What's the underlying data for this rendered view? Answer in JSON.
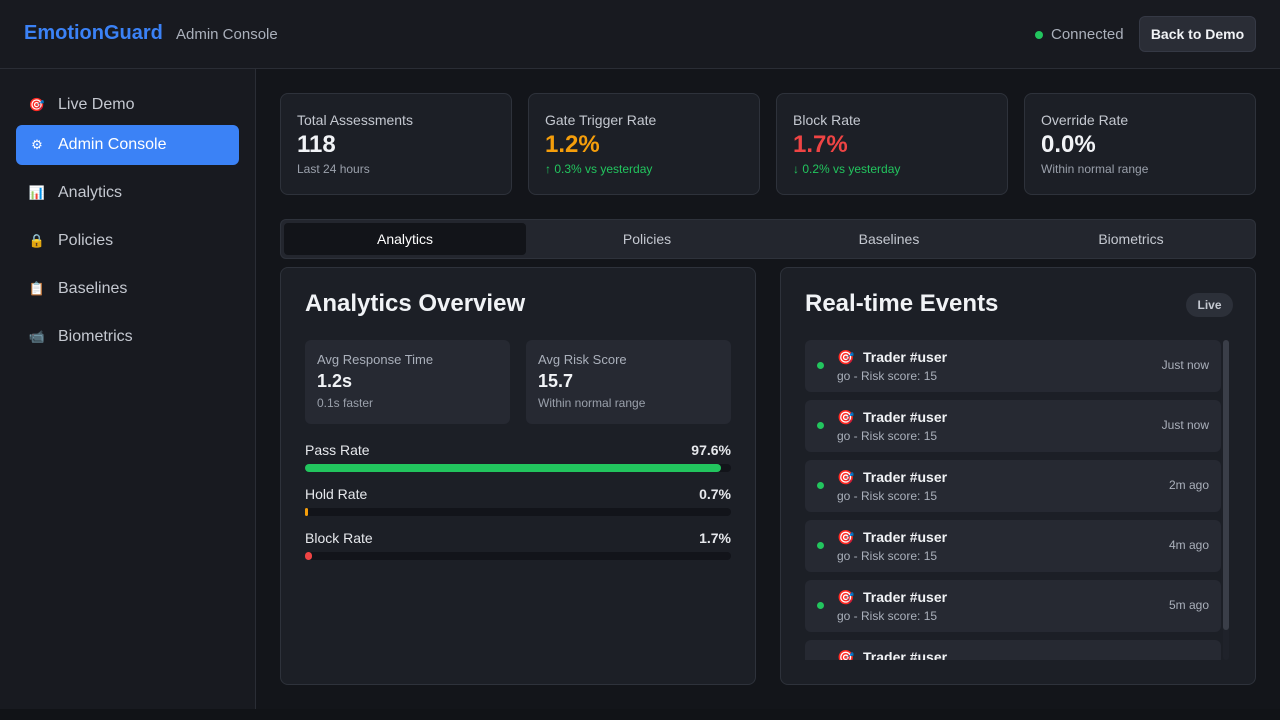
{
  "header": {
    "brand": "EmotionGuard",
    "subtitle": "Admin Console",
    "status": "Connected",
    "back_button": "Back to Demo"
  },
  "sidebar": {
    "items": [
      {
        "icon": "target-icon",
        "glyph": "🎯",
        "label": "Live Demo",
        "active": false
      },
      {
        "icon": "gear-icon",
        "glyph": "⚙",
        "label": "Admin Console",
        "active": true
      },
      {
        "icon": "bar-chart-icon",
        "glyph": "📊",
        "label": "Analytics",
        "active": false
      },
      {
        "icon": "lock-icon",
        "glyph": "🔒",
        "label": "Policies",
        "active": false
      },
      {
        "icon": "clipboard-icon",
        "glyph": "📋",
        "label": "Baselines",
        "active": false
      },
      {
        "icon": "camera-icon",
        "glyph": "📹",
        "label": "Biometrics",
        "active": false
      }
    ]
  },
  "stats": [
    {
      "label": "Total Assessments",
      "value": "118",
      "sub": "Last 24 hours"
    },
    {
      "label": "Gate Trigger Rate",
      "value": "1.2%",
      "sub": "↑ 0.3% vs yesterday"
    },
    {
      "label": "Block Rate",
      "value": "1.7%",
      "sub": "↓ 0.2% vs yesterday"
    },
    {
      "label": "Override Rate",
      "value": "0.0%",
      "sub": "Within normal range"
    }
  ],
  "tabs": [
    "Analytics",
    "Policies",
    "Baselines",
    "Biometrics"
  ],
  "analytics": {
    "title": "Analytics Overview",
    "avg_response": {
      "label": "Avg Response Time",
      "value": "1.2s",
      "sub": "0.1s faster"
    },
    "avg_risk": {
      "label": "Avg Risk Score",
      "value": "15.7",
      "sub": "Within normal range"
    },
    "rates": [
      {
        "label": "Pass Rate",
        "value": "97.6%",
        "fraction": 0.976
      },
      {
        "label": "Hold Rate",
        "value": "0.7%",
        "fraction": 0.007
      },
      {
        "label": "Block Rate",
        "value": "1.7%",
        "fraction": 0.017
      }
    ],
    "colors": {
      "pass": "#22c55e",
      "hold": "#f59e0b",
      "block": "#ef4444"
    }
  },
  "events": {
    "title": "Real-time Events",
    "badge": "Live",
    "items": [
      {
        "title": "Trader #user",
        "sub": "go - Risk score: 15",
        "time": "Just now"
      },
      {
        "title": "Trader #user",
        "sub": "go - Risk score: 15",
        "time": "Just now"
      },
      {
        "title": "Trader #user",
        "sub": "go - Risk score: 15",
        "time": "2m ago"
      },
      {
        "title": "Trader #user",
        "sub": "go - Risk score: 15",
        "time": "4m ago"
      },
      {
        "title": "Trader #user",
        "sub": "go - Risk score: 15",
        "time": "5m ago"
      },
      {
        "title": "Trader #user",
        "sub": "",
        "time": ""
      }
    ]
  }
}
